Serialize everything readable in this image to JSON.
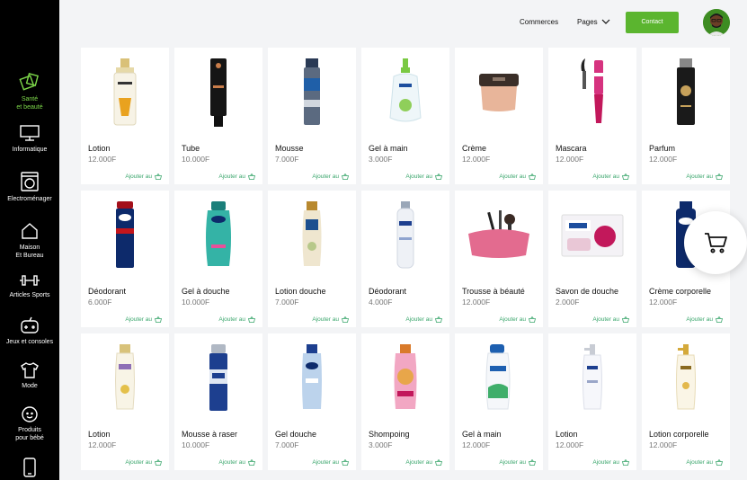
{
  "sidebar": {
    "items": [
      {
        "label_1": "Santé",
        "label_2": "et beauté",
        "icon": "beauty-icon"
      },
      {
        "label_1": "Informatique",
        "label_2": "",
        "icon": "monitor-icon"
      },
      {
        "label_1": "Electroménager",
        "label_2": "",
        "icon": "washing-machine-icon"
      },
      {
        "label_1": "Maison",
        "label_2": "Et Bureau",
        "icon": "house-icon"
      },
      {
        "label_1": "Articles Sports",
        "label_2": "",
        "icon": "dumbbell-icon"
      },
      {
        "label_1": "Jeux et consoles",
        "label_2": "",
        "icon": "gamepad-icon"
      },
      {
        "label_1": "Mode",
        "label_2": "",
        "icon": "tshirt-icon"
      },
      {
        "label_1": "Produits",
        "label_2": "pour bébé",
        "icon": "baby-icon"
      },
      {
        "label_1": "",
        "label_2": "",
        "icon": "phone-icon"
      }
    ]
  },
  "header": {
    "commerces": "Commerces",
    "pages": "Pages",
    "contact": "Contact"
  },
  "colors": {
    "accent": "#5bb52f",
    "active_nav": "#7dd84a",
    "add_link": "#3aa66c"
  },
  "products": [
    {
      "name": "Lotion",
      "price": "12.000F",
      "add": "Ajouter au"
    },
    {
      "name": "Tube",
      "price": "10.000F",
      "add": "Ajouter au"
    },
    {
      "name": "Mousse",
      "price": "7.000F",
      "add": "Ajouter au"
    },
    {
      "name": "Gel à main",
      "price": "3.000F",
      "add": "Ajouter au"
    },
    {
      "name": "Crème",
      "price": "12.000F",
      "add": "Ajouter au"
    },
    {
      "name": "Mascara",
      "price": "12.000F",
      "add": "Ajouter au"
    },
    {
      "name": "Parfum",
      "price": "12.000F",
      "add": "Ajouter au"
    },
    {
      "name": "Déodorant",
      "price": "6.000F",
      "add": "Ajouter au"
    },
    {
      "name": "Gel à douche",
      "price": "10.000F",
      "add": "Ajouter au"
    },
    {
      "name": "Lotion douche",
      "price": "7.000F",
      "add": "Ajouter au"
    },
    {
      "name": "Déodorant",
      "price": "4.000F",
      "add": "Ajouter au"
    },
    {
      "name": "Trousse à béauté",
      "price": "12.000F",
      "add": "Ajouter au"
    },
    {
      "name": "Savon de douche",
      "price": "2.000F",
      "add": "Ajouter au"
    },
    {
      "name": "Crème corporelle",
      "price": "12.000F",
      "add": "Ajouter au"
    },
    {
      "name": "Lotion",
      "price": "12.000F",
      "add": "Ajouter au"
    },
    {
      "name": "Mousse à raser",
      "price": "10.000F",
      "add": "Ajouter au"
    },
    {
      "name": "Gel douche",
      "price": "7.000F",
      "add": "Ajouter au"
    },
    {
      "name": "Shompoing",
      "price": "3.000F",
      "add": "Ajouter au"
    },
    {
      "name": "Gel à main",
      "price": "12.000F",
      "add": "Ajouter au"
    },
    {
      "name": "Lotion",
      "price": "12.000F",
      "add": "Ajouter au"
    },
    {
      "name": "Lotion corporelle",
      "price": "12.000F",
      "add": "Ajouter au"
    }
  ]
}
